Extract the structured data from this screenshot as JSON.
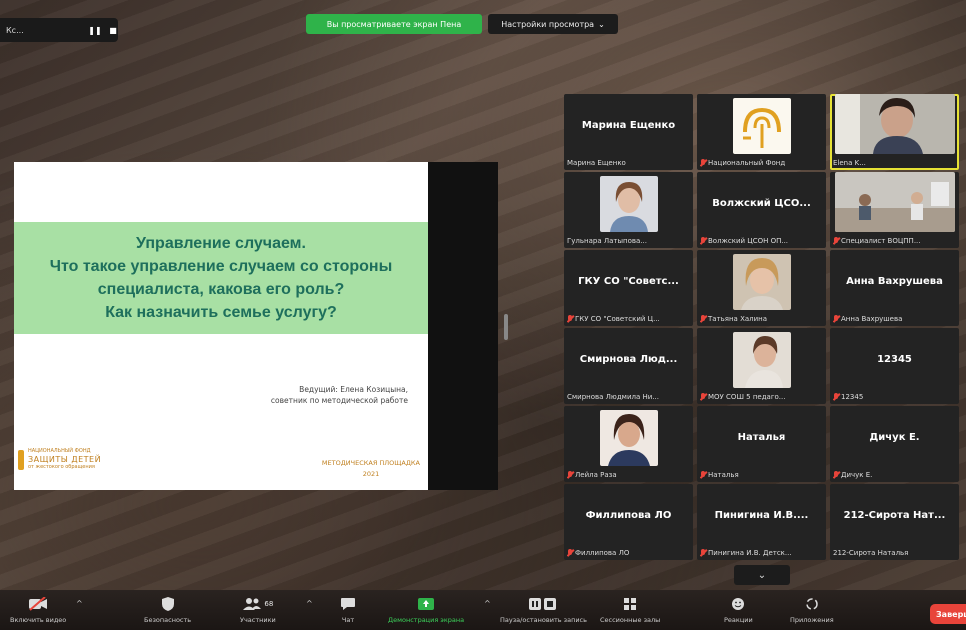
{
  "top": {
    "left_label": "Кс...",
    "banner": "Вы просматриваете экран Пена",
    "view_options": "Настройки просмотра",
    "view_options_caret": "⌄"
  },
  "slide": {
    "title_lines": [
      "Управление случаем.",
      "Что такое управление случаем со стороны",
      "специалиста, какова его роль?",
      "Как назначить семье услугу?"
    ],
    "presenter_line1": "Ведущий: Елена Козицына,",
    "presenter_line2": "советник по методической работе",
    "logo_small": "НАЦИОНАЛЬНЫЙ ФОНД",
    "logo_big": "ЗАЩИТЫ ДЕТЕЙ",
    "logo_tag": "от жестокого обращения",
    "footer_line1": "МЕТОДИЧЕСКАЯ ПЛОЩАДКА",
    "footer_line2": "2021"
  },
  "participants": [
    {
      "big": "Марина Ещенко",
      "name": "Марина Ещенко",
      "muted": false,
      "photo": "none"
    },
    {
      "big": "",
      "name": "Национальный Фонд",
      "muted": true,
      "photo": "logo"
    },
    {
      "big": "",
      "name": "Elena K...",
      "muted": false,
      "photo": "woman-dark",
      "active": true
    },
    {
      "big": "",
      "name": "Гульнара Латыпова...",
      "muted": false,
      "photo": "woman-light"
    },
    {
      "big": "Волжский ЦСО...",
      "name": "Волжский ЦСОН ОП...",
      "muted": true,
      "photo": "none"
    },
    {
      "big": "",
      "name": "Специалист ВОЦПП...",
      "muted": true,
      "photo": "room"
    },
    {
      "big": "ГКУ СО \"Советс...",
      "name": "ГКУ СО \"Советский Ц...",
      "muted": true,
      "photo": "none"
    },
    {
      "big": "",
      "name": "Татьяна Халина",
      "muted": true,
      "photo": "woman-blonde"
    },
    {
      "big": "Анна Вахрушева",
      "name": "Анна Вахрушева",
      "muted": true,
      "photo": "none"
    },
    {
      "big": "Смирнова Люд...",
      "name": "Смирнова Людмила Ни...",
      "muted": false,
      "photo": "none"
    },
    {
      "big": "",
      "name": "МОУ СОШ 5 педаго...",
      "muted": true,
      "photo": "woman-light2"
    },
    {
      "big": "12345",
      "name": "12345",
      "muted": true,
      "photo": "none"
    },
    {
      "big": "",
      "name": "Лейла Раза",
      "muted": true,
      "photo": "woman-brunette"
    },
    {
      "big": "Наталья",
      "name": "Наталья",
      "muted": true,
      "photo": "none"
    },
    {
      "big": "Дичук Е.",
      "name": "Дичук Е.",
      "muted": true,
      "photo": "none"
    },
    {
      "big": "Филлипова ЛО",
      "name": "Филлипова ЛО",
      "muted": true,
      "photo": "none"
    },
    {
      "big": "Пинигина И.В....",
      "name": "Пинигина И.В. Детск...",
      "muted": true,
      "photo": "none"
    },
    {
      "big": "212-Сирота Нат...",
      "name": "212-Сирота Наталья",
      "muted": false,
      "photo": "none"
    }
  ],
  "grid_chevron": "⌄",
  "toolbar": {
    "video": "Включить видео",
    "security": "Безопасность",
    "participants": "Участники",
    "participants_count": "68",
    "chat": "Чат",
    "share": "Демонстрация экрана",
    "record": "Пауза/остановить запись",
    "rooms": "Сессионные залы",
    "reactions": "Реакции",
    "apps": "Приложения",
    "end": "Завершить"
  },
  "colors": {
    "banner": "#2fb34a",
    "active_outline": "#e6e235",
    "muted_icon": "#e8443a",
    "end": "#e8443a"
  }
}
